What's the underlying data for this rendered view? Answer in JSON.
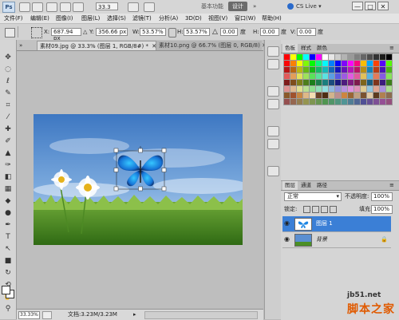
{
  "app": {
    "logo": "Ps",
    "zoom": "33.3",
    "workspaces": [
      "基本功能",
      "设计",
      "»"
    ],
    "cs_live": "CS Live ▾",
    "window_buttons": [
      "—",
      "□",
      "✕"
    ]
  },
  "menu": [
    "文件(F)",
    "编辑(E)",
    "图像(I)",
    "图层(L)",
    "选择(S)",
    "滤镜(T)",
    "分析(A)",
    "3D(D)",
    "视图(V)",
    "窗口(W)",
    "帮助(H)"
  ],
  "options": {
    "x_label": "X:",
    "x_value": "687.94 px",
    "y_label": "Y:",
    "y_value": "356.66 px",
    "w_label": "W:",
    "w_value": "53.57%",
    "h_label": "H:",
    "h_value": "53.57%",
    "angle_value": "0.00",
    "angle_unit": "度",
    "hskew_label": "H:",
    "hskew_value": "0.00",
    "hskew_unit": "度",
    "vskew_label": "V:",
    "vskew_value": "0.00",
    "vskew_unit": "度"
  },
  "tabs": [
    {
      "label": "素材09.jpg @ 33.3% (图层 1, RGB/8#) *",
      "close": "✕"
    },
    {
      "label": "素材10.png @ 66.7% (图层 0, RGB/8) ✕"
    }
  ],
  "status": {
    "zoom": "33.33%",
    "doc_size": "文档:3.23M/3.23M"
  },
  "panels": {
    "swatch_tabs": [
      "色板",
      "样式",
      "颜色"
    ],
    "layer_tabs": [
      "图层",
      "通道",
      "路径"
    ],
    "blend_mode": "正常",
    "opacity_label": "不透明度:",
    "opacity_value": "100%",
    "lock_label": "锁定:",
    "fill_label": "填充:",
    "fill_value": "100%",
    "layers": [
      {
        "name": "图层 1",
        "selected": true
      },
      {
        "name": "背景",
        "selected": false
      }
    ]
  },
  "watermark": {
    "site": "jb51.net",
    "name": "脚本之家"
  },
  "colors": {
    "selected_layer": "#3b7fd6",
    "workspace_active": "#6b6b6b"
  }
}
